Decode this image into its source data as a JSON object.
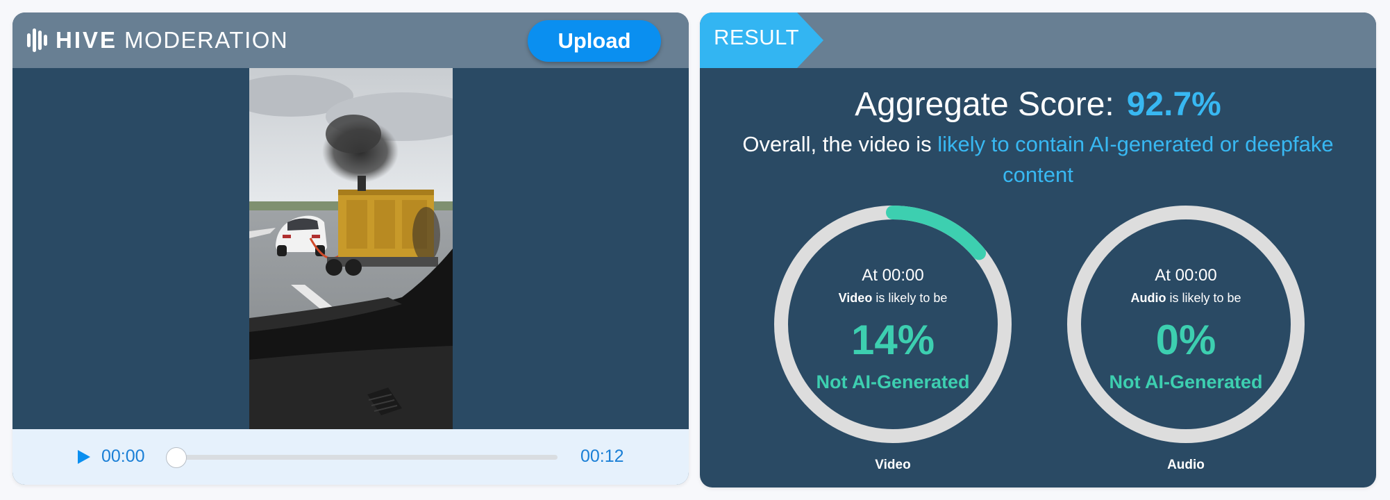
{
  "brand": {
    "name_bold": "HIVE",
    "name_light": "MODERATION"
  },
  "toolbar": {
    "upload_label": "Upload"
  },
  "player": {
    "current_time": "00:00",
    "total_time": "00:12",
    "progress": 0.0
  },
  "result": {
    "tag_label": "RESULT",
    "aggregate_label": "Aggregate Score:",
    "aggregate_value": "92.7%",
    "summary_prefix": "Overall, the video is ",
    "summary_highlight": "likely to contain AI-generated or deepfake content"
  },
  "gauges": [
    {
      "time_label": "At 00:00",
      "type_bold": "Video",
      "likely_text": " is likely to be",
      "percent": "14%",
      "percent_value": 14,
      "verdict": "Not AI-Generated",
      "caption": "Video"
    },
    {
      "time_label": "At 00:00",
      "type_bold": "Audio",
      "likely_text": " is likely to be",
      "percent": "0%",
      "percent_value": 0,
      "verdict": "Not AI-Generated",
      "caption": "Audio"
    }
  ],
  "colors": {
    "panel_bg": "#2a4a64",
    "header_bg": "#687f93",
    "accent_blue": "#38b8f2",
    "upload_blue": "#0a8ff0",
    "teal": "#3dcfb0",
    "ring_track": "#dddddd",
    "controls_bg": "#e6f1fc"
  },
  "icons": {
    "logo": "hive-logo-icon",
    "play": "play-icon",
    "thumbnail": "video-thumbnail"
  }
}
